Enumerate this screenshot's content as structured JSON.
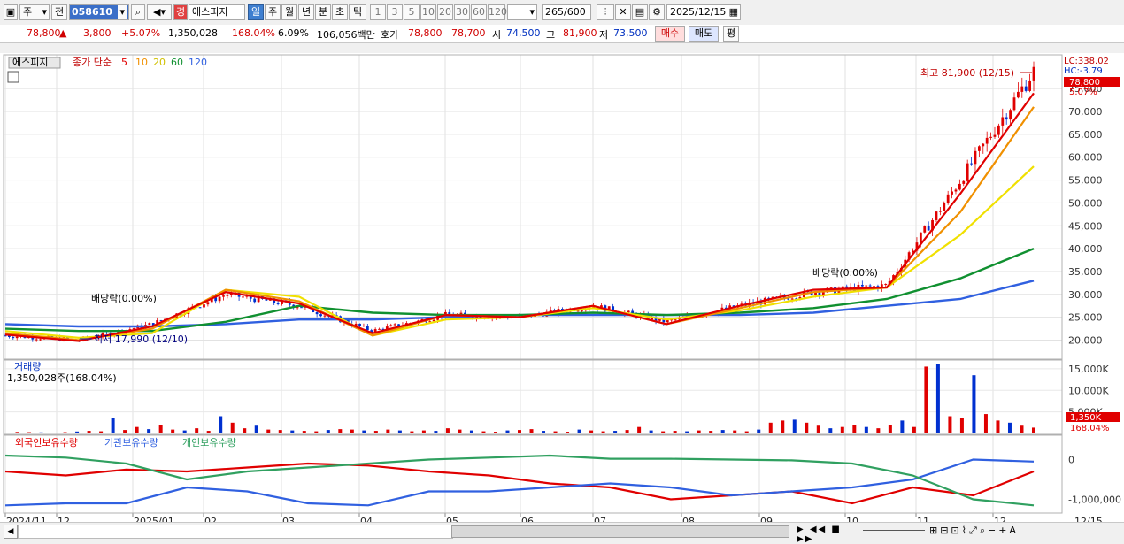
{
  "toolbar": {
    "mode": "주",
    "prev_label": "전",
    "code": "058610",
    "ctrl_label": "경",
    "name": "에스피지",
    "periods": [
      "일",
      "주",
      "월",
      "년",
      "분",
      "초",
      "틱"
    ],
    "numbers": [
      "1",
      "3",
      "5",
      "10",
      "20",
      "30",
      "60",
      "120"
    ],
    "count": "265",
    "count_max": "/600",
    "date": "2025/12/15"
  },
  "quote": {
    "price": "78,800",
    "arrow": "▲",
    "change": "3,800",
    "change_pct": "+5.07%",
    "volume": "1,350,028",
    "volume_ratio": "168.04%",
    "turnover": "6.09%",
    "amount": "106,056백만",
    "ask_label": "호가",
    "ask": "78,800",
    "bid": "78,700",
    "open_label": "시",
    "open": "74,500",
    "high_label": "고",
    "high": "81,900",
    "low_label": "저",
    "low": "73,500",
    "buy_label": "매수",
    "sell_label": "매도",
    "avg_label": "평"
  },
  "legend": {
    "stock_name": "에스피지",
    "ma_label": "종가 단순",
    "ma_periods": [
      "5",
      "10",
      "20",
      "60",
      "120"
    ],
    "ma_colors": [
      "#e00000",
      "#f09000",
      "#e8e800",
      "#109030",
      "#3060e0"
    ]
  },
  "annotations": {
    "high_note": "최고 81,900 (12/15)",
    "low_note": "최저 17,990 (12/10)",
    "dividend_1": "배당락(0.00%)",
    "dividend_2": "배당락(0.00%)",
    "lc": "LC:338.02",
    "hc": "HC:-3.79",
    "last_price": "78,800",
    "last_pct": "5.07%"
  },
  "volume_panel": {
    "title": "거래량",
    "value": "1,350,028주(168.04%)",
    "ticks": [
      "15,000K",
      "10,000K",
      "5,000K"
    ],
    "last": "1,350K",
    "last_pct": "168.04%"
  },
  "holdings_panel": {
    "series_labels": [
      "외국인보유수량",
      "기관보유수량",
      "개인보유수량"
    ],
    "series_colors": [
      "#e00000",
      "#3060e0",
      "#30a060"
    ],
    "ticks": [
      "0",
      "-1,000,000"
    ]
  },
  "x_labels": [
    "2024/11",
    "12",
    "2025/01",
    "02",
    "03",
    "04",
    "05",
    "06",
    "07",
    "08",
    "09",
    "10",
    "11",
    "12",
    "12/15"
  ],
  "chart_data": [
    {
      "type": "line",
      "title": "",
      "x": [
        "2024/11",
        "12",
        "2025/01",
        "02",
        "03",
        "04",
        "05",
        "06",
        "07",
        "08",
        "09",
        "10",
        "11",
        "12",
        "12/15"
      ],
      "ylabel": "",
      "ylim": [
        17000,
        82000
      ],
      "y_ticks": [
        20000,
        25000,
        30000,
        35000,
        40000,
        45000,
        50000,
        55000,
        60000,
        65000,
        70000,
        75000
      ],
      "y_tick_labels": [
        "20,000",
        "25,000",
        "30,000",
        "35,000",
        "40,000",
        "45,000",
        "50,000",
        "55,000",
        "60,000",
        "65,000",
        "70,000",
        "75,000"
      ],
      "series": [
        {
          "name": "종가",
          "values": [
            21000,
            20000,
            23500,
            30000,
            27500,
            22000,
            25500,
            25000,
            27500,
            24000,
            27500,
            30500,
            32000,
            55000,
            78800
          ]
        },
        {
          "name": "5",
          "values": [
            21200,
            19800,
            23000,
            30500,
            28000,
            21500,
            25500,
            25000,
            27500,
            23500,
            27500,
            31000,
            31500,
            52000,
            74000
          ]
        },
        {
          "name": "10",
          "values": [
            21500,
            20000,
            22500,
            31000,
            28500,
            21000,
            25500,
            25000,
            27500,
            23500,
            27000,
            30500,
            31500,
            48000,
            71000
          ]
        },
        {
          "name": "20",
          "values": [
            22000,
            20500,
            21500,
            31000,
            29500,
            21000,
            24500,
            25000,
            27000,
            24500,
            26500,
            29500,
            31500,
            43000,
            58000
          ]
        },
        {
          "name": "60",
          "values": [
            22500,
            22000,
            22000,
            24000,
            27500,
            26000,
            25500,
            25500,
            26000,
            25500,
            26000,
            27000,
            29000,
            33500,
            40000
          ]
        },
        {
          "name": "120",
          "values": [
            23500,
            23000,
            23000,
            23500,
            24500,
            24500,
            25000,
            25500,
            25500,
            25500,
            25500,
            26000,
            27500,
            29000,
            33000
          ]
        }
      ]
    },
    {
      "type": "bar",
      "title": "거래량",
      "ylabel": "",
      "ylim": [
        0,
        16000
      ],
      "y_unit": "K",
      "values": [
        200,
        350,
        300,
        250,
        200,
        300,
        450,
        600,
        500,
        3500,
        800,
        1500,
        1000,
        2000,
        900,
        700,
        1200,
        600,
        4000,
        2500,
        1200,
        1800,
        900,
        800,
        700,
        600,
        500,
        800,
        1000,
        900,
        700,
        600,
        900,
        700,
        500,
        700,
        600,
        1200,
        900,
        700,
        500,
        400,
        700,
        800,
        1000,
        600,
        500,
        400,
        900,
        700,
        500,
        600,
        800,
        1500,
        700,
        500,
        600,
        500,
        700,
        600,
        800,
        700,
        500,
        900,
        2500,
        3000,
        3200,
        2500,
        1800,
        1200,
        1500,
        2000,
        1500,
        1200,
        2000,
        3000,
        1500,
        15500,
        16000,
        4000,
        3500,
        13500,
        4500,
        3000,
        2500,
        1800,
        1350
      ]
    },
    {
      "type": "line",
      "title": "",
      "ylim": [
        -1300000,
        300000
      ],
      "y_ticks": [
        0,
        -1000000
      ],
      "series": [
        {
          "name": "외국인보유수량",
          "values": [
            -300000,
            -400000,
            -250000,
            -300000,
            -200000,
            -100000,
            -150000,
            -300000,
            -400000,
            -600000,
            -700000,
            -1000000,
            -900000,
            -800000,
            -1100000,
            -700000,
            -900000,
            -300000
          ]
        },
        {
          "name": "기관보유수량",
          "values": [
            -1150000,
            -1100000,
            -1100000,
            -700000,
            -800000,
            -1100000,
            -1150000,
            -800000,
            -800000,
            -700000,
            -600000,
            -700000,
            -900000,
            -800000,
            -700000,
            -500000,
            0,
            -50000
          ]
        },
        {
          "name": "개인보유수량",
          "values": [
            100000,
            50000,
            -100000,
            -500000,
            -300000,
            -200000,
            -100000,
            0,
            50000,
            100000,
            20000,
            20000,
            0,
            -20000,
            -100000,
            -400000,
            -1000000,
            -1150000
          ]
        }
      ]
    }
  ]
}
